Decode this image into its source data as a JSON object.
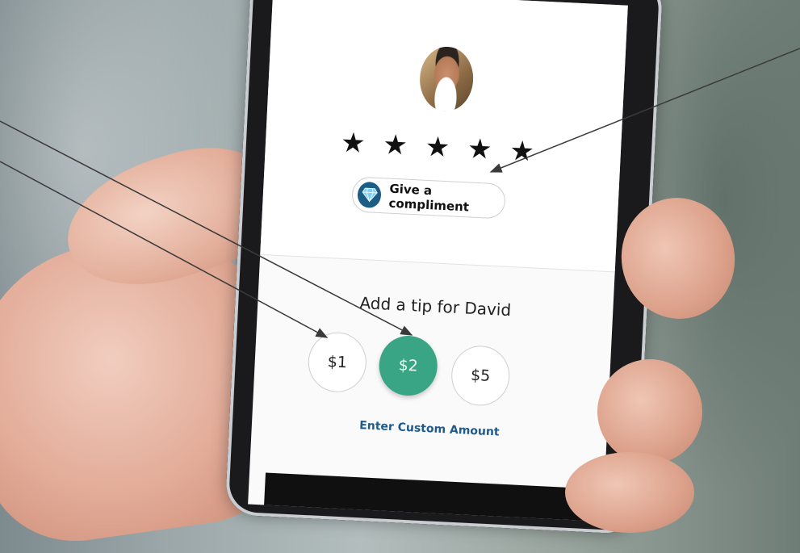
{
  "rating": {
    "stars": [
      "★",
      "★",
      "★",
      "★",
      "★"
    ],
    "compliment_label": "Give a compliment",
    "compliment_icon": "diamond-icon"
  },
  "tip": {
    "title": "Add a tip for David",
    "options": [
      {
        "label": "$1",
        "selected": false
      },
      {
        "label": "$2",
        "selected": true
      },
      {
        "label": "$5",
        "selected": false
      }
    ],
    "custom_label": "Enter Custom Amount"
  },
  "colors": {
    "accent_green": "#3aa585",
    "link_blue": "#1f5b8a",
    "gem_blue": "#1c5d86"
  }
}
